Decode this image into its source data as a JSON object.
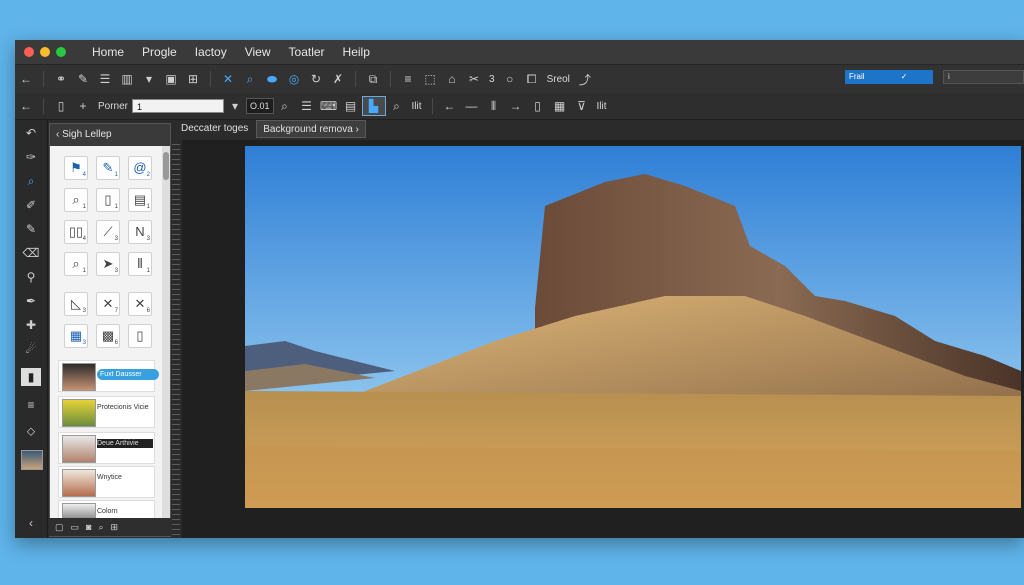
{
  "menu": [
    "Home",
    "Progle",
    "Iactoy",
    "View",
    "Toatler",
    "Heilp"
  ],
  "toolbar1": {
    "count_value": "3",
    "select_label": "Sreol",
    "preset_value": "Frail",
    "preset_check": "✓",
    "field2_value": "i"
  },
  "toolbar2": {
    "pointer_label": "Porner",
    "pointer_value": "1",
    "zoom_value": "O.01",
    "split_label": "Ilit",
    "split_label2": "Ilit"
  },
  "tabs": [
    "Deccater toges",
    "Background remova"
  ],
  "panel": {
    "title": "Sigh Lellep",
    "items": [
      {
        "label": "Fuxt Dausser"
      },
      {
        "label": "Protecionis Vicie"
      },
      {
        "label": "Deue Arthivie"
      },
      {
        "label": "Wnytice"
      },
      {
        "label": "Colorn"
      }
    ]
  },
  "icon_grid_numbers": [
    "4",
    "1",
    "2",
    "1",
    "1",
    "1",
    "4",
    "3",
    "3",
    "1",
    "3",
    "1",
    "3",
    "7",
    "6",
    "3",
    "6",
    ""
  ],
  "colors": {
    "accent": "#1e74c9",
    "window": "#2b2b2b",
    "background": "#5fb4ea"
  }
}
